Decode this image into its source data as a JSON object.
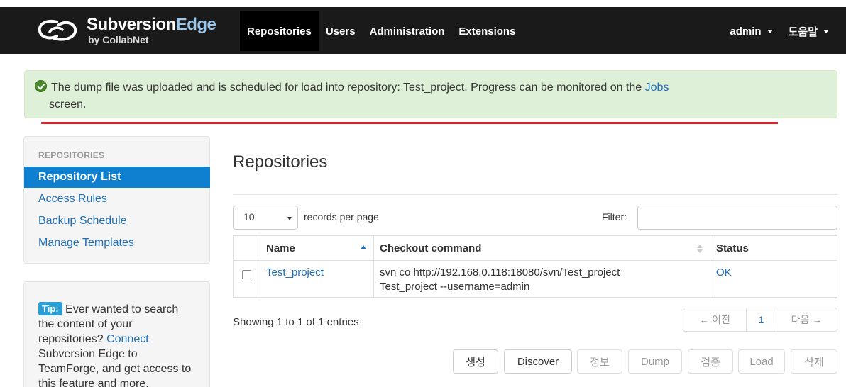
{
  "brand": {
    "name_main": "Subversion",
    "name_accent": "Edge",
    "byline": "by CollabNet"
  },
  "nav": {
    "items": [
      {
        "label": "Repositories",
        "active": true
      },
      {
        "label": "Users",
        "active": false
      },
      {
        "label": "Administration",
        "active": false
      },
      {
        "label": "Extensions",
        "active": false
      }
    ],
    "user_menu": "admin",
    "help_menu": "도움말"
  },
  "alert": {
    "message_before": "The dump file was uploaded and is scheduled for load into repository: Test_project. Progress can be monitored on the ",
    "link": "Jobs",
    "message_after": "screen."
  },
  "sidebar": {
    "header": "REPOSITORIES",
    "items": [
      {
        "label": "Repository List",
        "active": true
      },
      {
        "label": "Access Rules",
        "active": false
      },
      {
        "label": "Backup Schedule",
        "active": false
      },
      {
        "label": "Manage Templates",
        "active": false
      }
    ]
  },
  "tip": {
    "badge": "Tip:",
    "text_before": "Ever wanted to search the content of your repositories?",
    "link": "Connect",
    "text_after": "Subversion Edge to TeamForge, and get access to this feature and more."
  },
  "main": {
    "title": "Repositories",
    "page_length": "10",
    "page_length_label": "records per page",
    "filter_label": "Filter:",
    "filter_value": "",
    "columns": [
      "Name",
      "Checkout command",
      "Status"
    ],
    "rows": [
      {
        "name": "Test_project",
        "checkout_line1": "svn co http://192.168.0.118:18080/svn/Test_project",
        "checkout_line2": "Test_project --username=admin",
        "status": "OK"
      }
    ],
    "info": "Showing 1 to 1 of 1 entries",
    "pagination": {
      "prev": "← 이전",
      "current": "1",
      "next": "다음 →"
    },
    "buttons": [
      {
        "label": "생성",
        "enabled": true
      },
      {
        "label": "Discover",
        "enabled": true
      },
      {
        "label": "정보",
        "enabled": false
      },
      {
        "label": "Dump",
        "enabled": false
      },
      {
        "label": "검증",
        "enabled": false
      },
      {
        "label": "Load",
        "enabled": false
      },
      {
        "label": "삭제",
        "enabled": false
      }
    ]
  },
  "colors": {
    "navbar": "#1a1a1a",
    "accent": "#0f7fcf",
    "link": "#1e6fba",
    "alert_bg": "#dff0d8",
    "annotation_line": "#e4222a"
  }
}
